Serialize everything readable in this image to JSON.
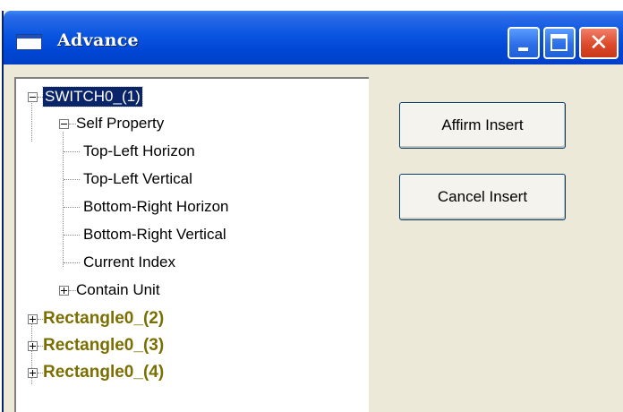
{
  "window": {
    "title": "Advance",
    "icons": {
      "app": "window-icon",
      "minimize": "minimize-icon",
      "maximize": "maximize-icon",
      "close": "close-icon"
    }
  },
  "tree": {
    "root": {
      "label": "SWITCH0_(1)",
      "expanded": true,
      "selected": true
    },
    "self_property": {
      "label": "Self Property",
      "expanded": true
    },
    "properties": [
      "Top-Left Horizon",
      "Top-Left Vertical",
      "Bottom-Right Horizon",
      "Bottom-Right Vertical",
      "Current Index"
    ],
    "contain_unit": {
      "label": "Contain Unit",
      "expanded": false
    },
    "others": [
      "Rectangle0_(2)",
      "Rectangle0_(3)",
      "Rectangle0_(4)"
    ]
  },
  "buttons": {
    "affirm": "Affirm Insert",
    "cancel": "Cancel Insert"
  },
  "colors": {
    "titlebar": "#0054e3",
    "selection": "#0a246a",
    "rectangle_label": "#7a6f00",
    "dialog_bg": "#ece9d8"
  }
}
